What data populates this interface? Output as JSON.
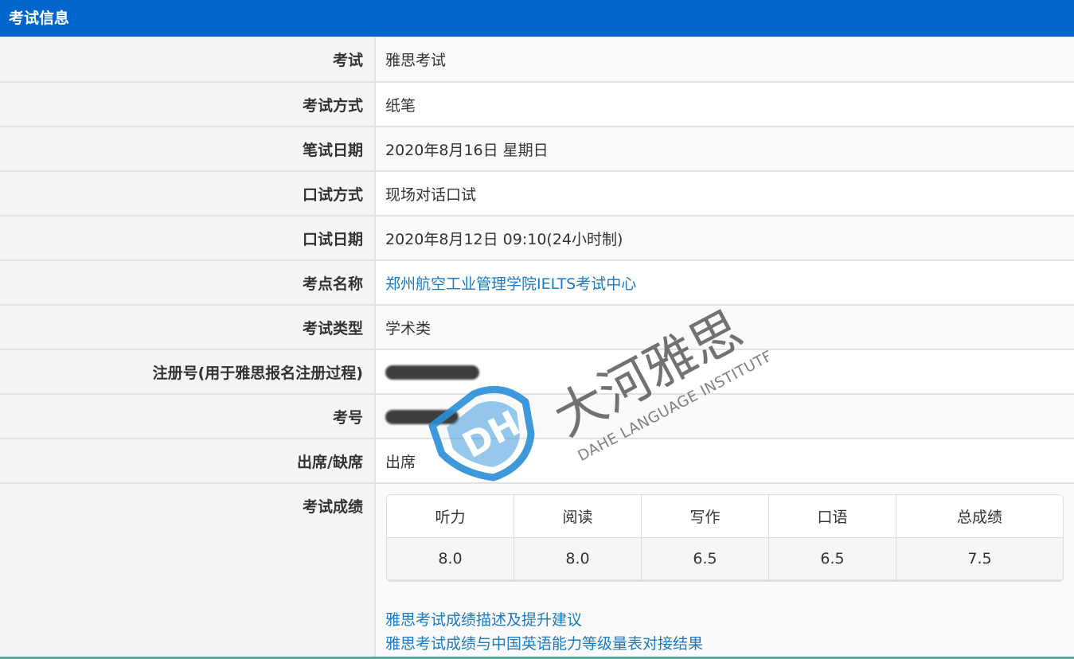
{
  "header": {
    "title": "考试信息"
  },
  "rows": [
    {
      "label": "考试",
      "value": "雅思考试"
    },
    {
      "label": "考试方式",
      "value": "纸笔"
    },
    {
      "label": "笔试日期",
      "value": "2020年8月16日 星期日"
    },
    {
      "label": "口试方式",
      "value": "现场对话口试"
    },
    {
      "label": "口试日期",
      "value": "2020年8月12日 09:10(24小时制)"
    },
    {
      "label": "考点名称",
      "value": "郑州航空工业管理学院IELTS考试中心"
    },
    {
      "label": "考试类型",
      "value": "学术类"
    },
    {
      "label": "注册号(用于雅思报名注册过程)",
      "value": ""
    },
    {
      "label": "考号",
      "value": ""
    },
    {
      "label": "出席/缺席",
      "value": "出席"
    }
  ],
  "scores": {
    "label": "考试成绩",
    "headers": [
      "听力",
      "阅读",
      "写作",
      "口语",
      "总成绩"
    ],
    "values": [
      "8.0",
      "8.0",
      "6.5",
      "6.5",
      "7.5"
    ]
  },
  "links": [
    "雅思考试成绩描述及提升建议",
    "雅思考试成绩与中国英语能力等级量表对接结果"
  ],
  "watermark": {
    "title": "大河雅思",
    "subtitle": "DAHE LANGUAGE INSTITUTE",
    "logo_text": "DH"
  },
  "colors": {
    "header_bg": "#0066cc",
    "link": "#1a7ac4",
    "watermark_blue": "#2a8fd8"
  }
}
